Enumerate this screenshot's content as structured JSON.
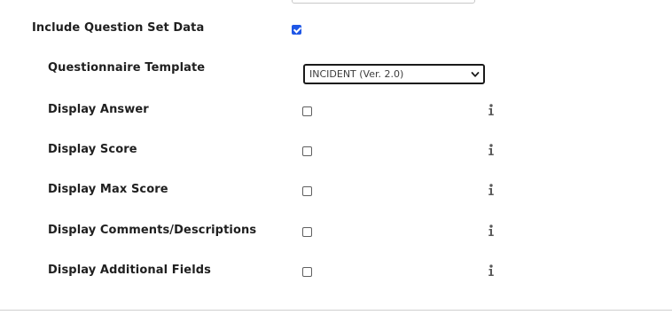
{
  "form": {
    "include_question_set": {
      "label": "Include Question Set Data",
      "checked": true
    },
    "questionnaire_template": {
      "label": "Questionnaire Template",
      "selected_value": "INCIDENT (Ver. 2.0)"
    },
    "options": [
      {
        "label": "Display Answer",
        "checked": false,
        "icon": "info-icon"
      },
      {
        "label": "Display Score",
        "checked": false,
        "icon": "info-icon"
      },
      {
        "label": "Display Max Score",
        "checked": false,
        "icon": "info-icon"
      },
      {
        "label": "Display Comments/Descriptions",
        "checked": false,
        "icon": "info-icon"
      },
      {
        "label": "Display Additional Fields",
        "checked": false,
        "icon": "info-icon"
      }
    ]
  },
  "colors": {
    "checkbox_checked": "#1f57e6",
    "info_icon": "#5a5a5a"
  }
}
